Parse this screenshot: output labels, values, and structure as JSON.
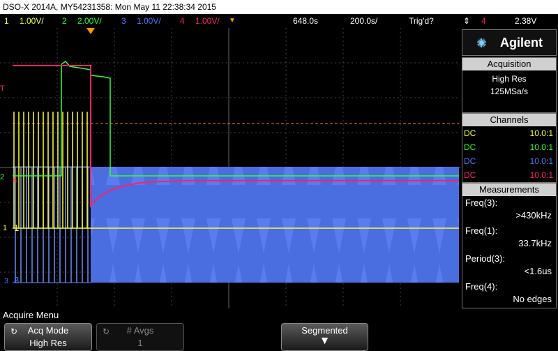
{
  "title_bar": {
    "text": "DSO-X 2014A, MY54231358: Mon May 11 22:38:34 2015"
  },
  "channel_bar": {
    "ch1_num": "1",
    "ch1_scale": "1.00V/",
    "ch2_num": "2",
    "ch2_scale": "2.00V/",
    "ch3_num": "3",
    "ch3_scale": "1.00V/",
    "ch4_num": "4",
    "ch4_scale": "1.00V/",
    "trigger_delay": "648.0s",
    "timebase": "200.0s/",
    "trigger_status": "Trig'd?",
    "trigger_source": "4",
    "trigger_level": "2.38V"
  },
  "brand": {
    "name": "Agilent"
  },
  "acquisition": {
    "header": "Acquisition",
    "mode": "High Res",
    "rate": "125MSa/s"
  },
  "channels": {
    "header": "Channels",
    "rows": [
      {
        "coupling": "DC",
        "ratio": "10.0:1",
        "color": "#ffff33"
      },
      {
        "coupling": "DC",
        "ratio": "10.0:1",
        "color": "#33ff33"
      },
      {
        "coupling": "DC",
        "ratio": "10.0:1",
        "color": "#5577ff"
      },
      {
        "coupling": "DC",
        "ratio": "10.0:1",
        "color": "#ff2266"
      }
    ]
  },
  "measurements": {
    "header": "Measurements",
    "items": [
      {
        "label": "Freq(3):",
        "value": ">430kHz"
      },
      {
        "label": "Freq(1):",
        "value": "33.7kHz"
      },
      {
        "label": "Period(3):",
        "value": "<1.6us"
      },
      {
        "label": "Freq(4):",
        "value": "No edges"
      }
    ]
  },
  "markers": {
    "ch1": "1",
    "ch2": "2",
    "ch3": "3",
    "ch4": "4",
    "trigger": "T"
  },
  "softkeys": {
    "menu_title": "Acquire Menu",
    "acq_mode_label": "Acq Mode",
    "acq_mode_value": "High Res",
    "avgs_label": "# Avgs",
    "avgs_value": "1",
    "segmented_label": "Segmented"
  },
  "colors": {
    "ch1": "#ffff33",
    "ch2": "#33ff33",
    "ch3": "#5577ff",
    "ch4": "#ff2266",
    "trigger_marker": "#ff9900"
  }
}
